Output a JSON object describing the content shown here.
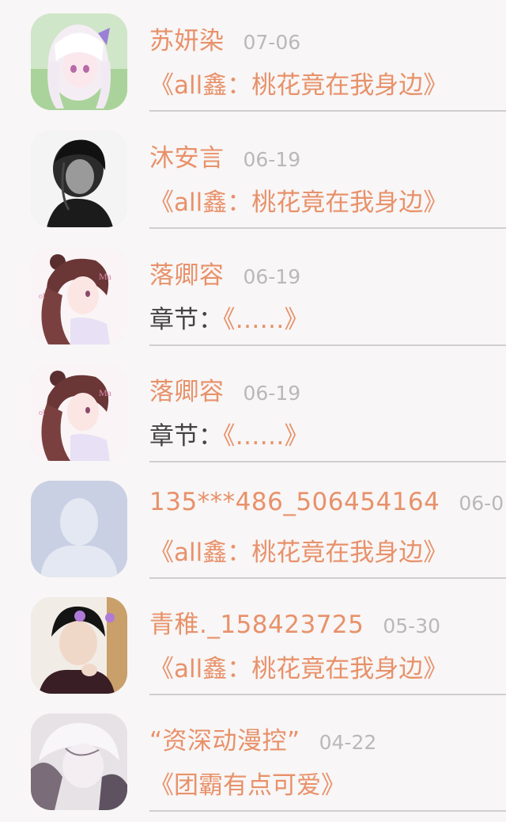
{
  "comments": [
    {
      "name": "苏妍染",
      "date": "07-06",
      "prefix": "",
      "message": "《all鑫：桃花竟在我身边》",
      "avatar": "anime-girl-white-hair-avatar"
    },
    {
      "name": "沐安言",
      "date": "06-19",
      "prefix": "",
      "message": "《all鑫：桃花竟在我身边》",
      "avatar": "monochrome-boy-avatar"
    },
    {
      "name": "落卿容",
      "date": "06-19",
      "prefix": "章节：",
      "message": "《……》",
      "avatar": "anime-girl-curly-hair-avatar"
    },
    {
      "name": "落卿容",
      "date": "06-19",
      "prefix": "章节：",
      "message": "《……》",
      "avatar": "anime-girl-curly-hair-avatar"
    },
    {
      "name": "135***486_506454164",
      "date": "06-0",
      "prefix": "",
      "message": "《all鑫：桃花竟在我身边》",
      "avatar": "default-person-avatar"
    },
    {
      "name": "青稚._158423725",
      "date": "05-30",
      "prefix": "",
      "message": "《all鑫：桃花竟在我身边》",
      "avatar": "boy-photo-avatar"
    },
    {
      "name": "“资深动漫控”",
      "date": "04-22",
      "prefix": "",
      "message": "《团霸有点可爱》",
      "avatar": "anime-boy-sketch-avatar"
    }
  ],
  "colors": {
    "name": "#e8916a",
    "date": "#b9b9b9",
    "prefix": "#444444",
    "divider": "#cfcfcf",
    "background": "#f8f6f6"
  }
}
